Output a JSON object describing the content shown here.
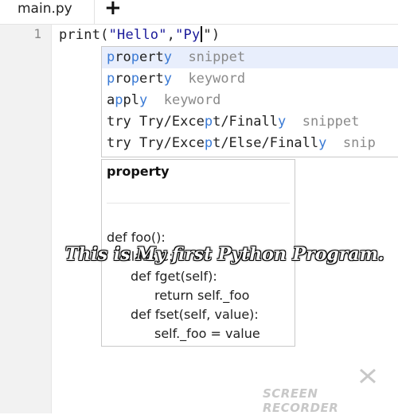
{
  "tab": {
    "filename": "main.py",
    "new_tab_label": "+"
  },
  "editor": {
    "line_number": "1",
    "code": {
      "fn": "print(",
      "arg1": "\"Hello\"",
      "comma": ",",
      "arg2": "\"Py",
      "after_caret": "\")"
    }
  },
  "autocomplete": {
    "items": [
      {
        "highlight_pre": "p",
        "middle": "ro",
        "mid_hl": "p",
        "rest": "erty",
        "last_hl": "y",
        "kind": "snippet"
      },
      {
        "label": "property",
        "kind": "keyword"
      },
      {
        "label": "apply",
        "kind": "keyword"
      },
      {
        "label": "try Try/Except/Finally",
        "kind": "snippet"
      },
      {
        "label": "try Try/Except/Else/Finally",
        "kind": "snip"
      }
    ]
  },
  "doc": {
    "title": "property",
    "lines": [
      "def foo():",
      "class C:",
      "def fget(self):",
      "return self._foo",
      "def fset(self, value):",
      "self._foo = value"
    ]
  },
  "overlay": {
    "caption": "This is My first Python Program."
  },
  "watermark": {
    "text": "SCREEN RECORDER"
  },
  "colors": {
    "highlight": "#3a7ad5",
    "selected_bg": "#e8eefc",
    "kind_text": "#8a8a8a"
  }
}
